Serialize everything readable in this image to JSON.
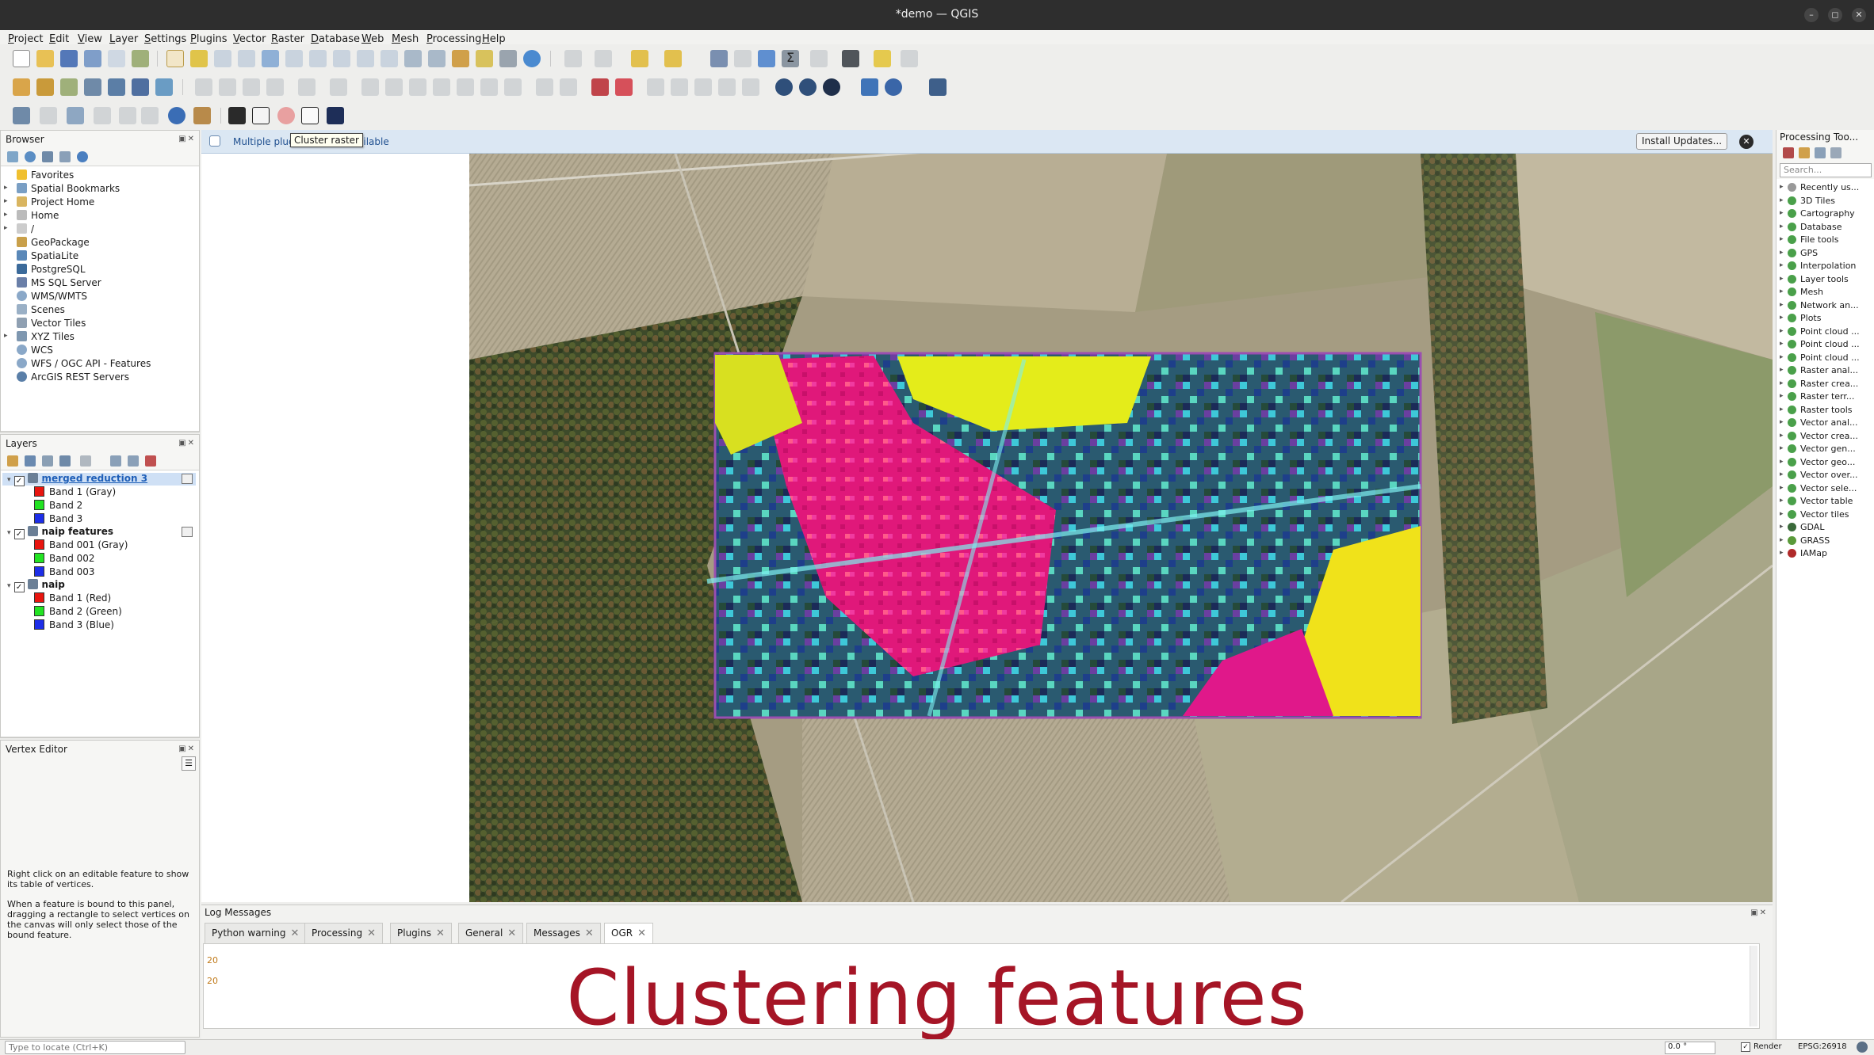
{
  "window": {
    "title": "*demo — QGIS"
  },
  "menus": [
    "Project",
    "Edit",
    "View",
    "Layer",
    "Settings",
    "Plugins",
    "Vector",
    "Raster",
    "Database",
    "Web",
    "Mesh",
    "Processing",
    "Help"
  ],
  "tooltip": "Cluster raster",
  "notice": {
    "text_left": "Multiple plug",
    "text_right": "ailable",
    "button": "Install Updates..."
  },
  "browser": {
    "title": "Browser",
    "items": [
      "Favorites",
      "Spatial Bookmarks",
      "Project Home",
      "Home",
      "/",
      "GeoPackage",
      "SpatiaLite",
      "PostgreSQL",
      "MS SQL Server",
      "WMS/WMTS",
      "Scenes",
      "Vector Tiles",
      "XYZ Tiles",
      "WCS",
      "WFS / OGC API - Features",
      "ArcGIS REST Servers"
    ]
  },
  "layers": {
    "title": "Layers",
    "groups": [
      {
        "name": "merged reduction 3",
        "bands": [
          {
            "label": "Band 1 (Gray)",
            "color": "#e8150f"
          },
          {
            "label": "Band 2",
            "color": "#22e322"
          },
          {
            "label": "Band 3",
            "color": "#1d2ee8"
          }
        ]
      },
      {
        "name": "naip features",
        "bands": [
          {
            "label": "Band 001 (Gray)",
            "color": "#e8150f"
          },
          {
            "label": "Band 002",
            "color": "#22e322"
          },
          {
            "label": "Band 003",
            "color": "#1d2ee8"
          }
        ]
      },
      {
        "name": "naip",
        "bands": [
          {
            "label": "Band 1 (Red)",
            "color": "#e8150f"
          },
          {
            "label": "Band 2 (Green)",
            "color": "#22e322"
          },
          {
            "label": "Band 3 (Blue)",
            "color": "#1d2ee8"
          }
        ]
      }
    ]
  },
  "vertex_editor": {
    "title": "Vertex Editor",
    "help1": "Right click on an editable feature to show its table of vertices.",
    "help2": "When a feature is bound to this panel, dragging a rectangle to select vertices on the canvas will only select those of the bound feature."
  },
  "processing": {
    "title": "Processing Too...",
    "search_placeholder": "Search...",
    "items": [
      "Recently us...",
      "3D Tiles",
      "Cartography",
      "Database",
      "File tools",
      "GPS",
      "Interpolation",
      "Layer tools",
      "Mesh",
      "Network an...",
      "Plots",
      "Point cloud ...",
      "Point cloud ...",
      "Point cloud ...",
      "Raster anal...",
      "Raster crea...",
      "Raster terr...",
      "Raster tools",
      "Vector anal...",
      "Vector crea...",
      "Vector gen...",
      "Vector geo...",
      "Vector over...",
      "Vector sele...",
      "Vector table",
      "Vector tiles",
      "GDAL",
      "GRASS",
      "IAMap"
    ]
  },
  "log": {
    "title": "Log Messages",
    "tabs": [
      "Python warning",
      "Processing",
      "Plugins",
      "General",
      "Messages",
      "OGR"
    ],
    "active_tab": "OGR",
    "lines": [
      "20",
      "20"
    ]
  },
  "caption": "Clustering features",
  "status": {
    "locator_placeholder": "Type to locate (Ctrl+K)",
    "rotation": "0.0 °",
    "render_label": "Render",
    "crs": "EPSG:26918"
  },
  "colors": {
    "caption": "#a51526",
    "selected_layer": "#3d7fd1",
    "titlebar": "#2e2e2e"
  }
}
